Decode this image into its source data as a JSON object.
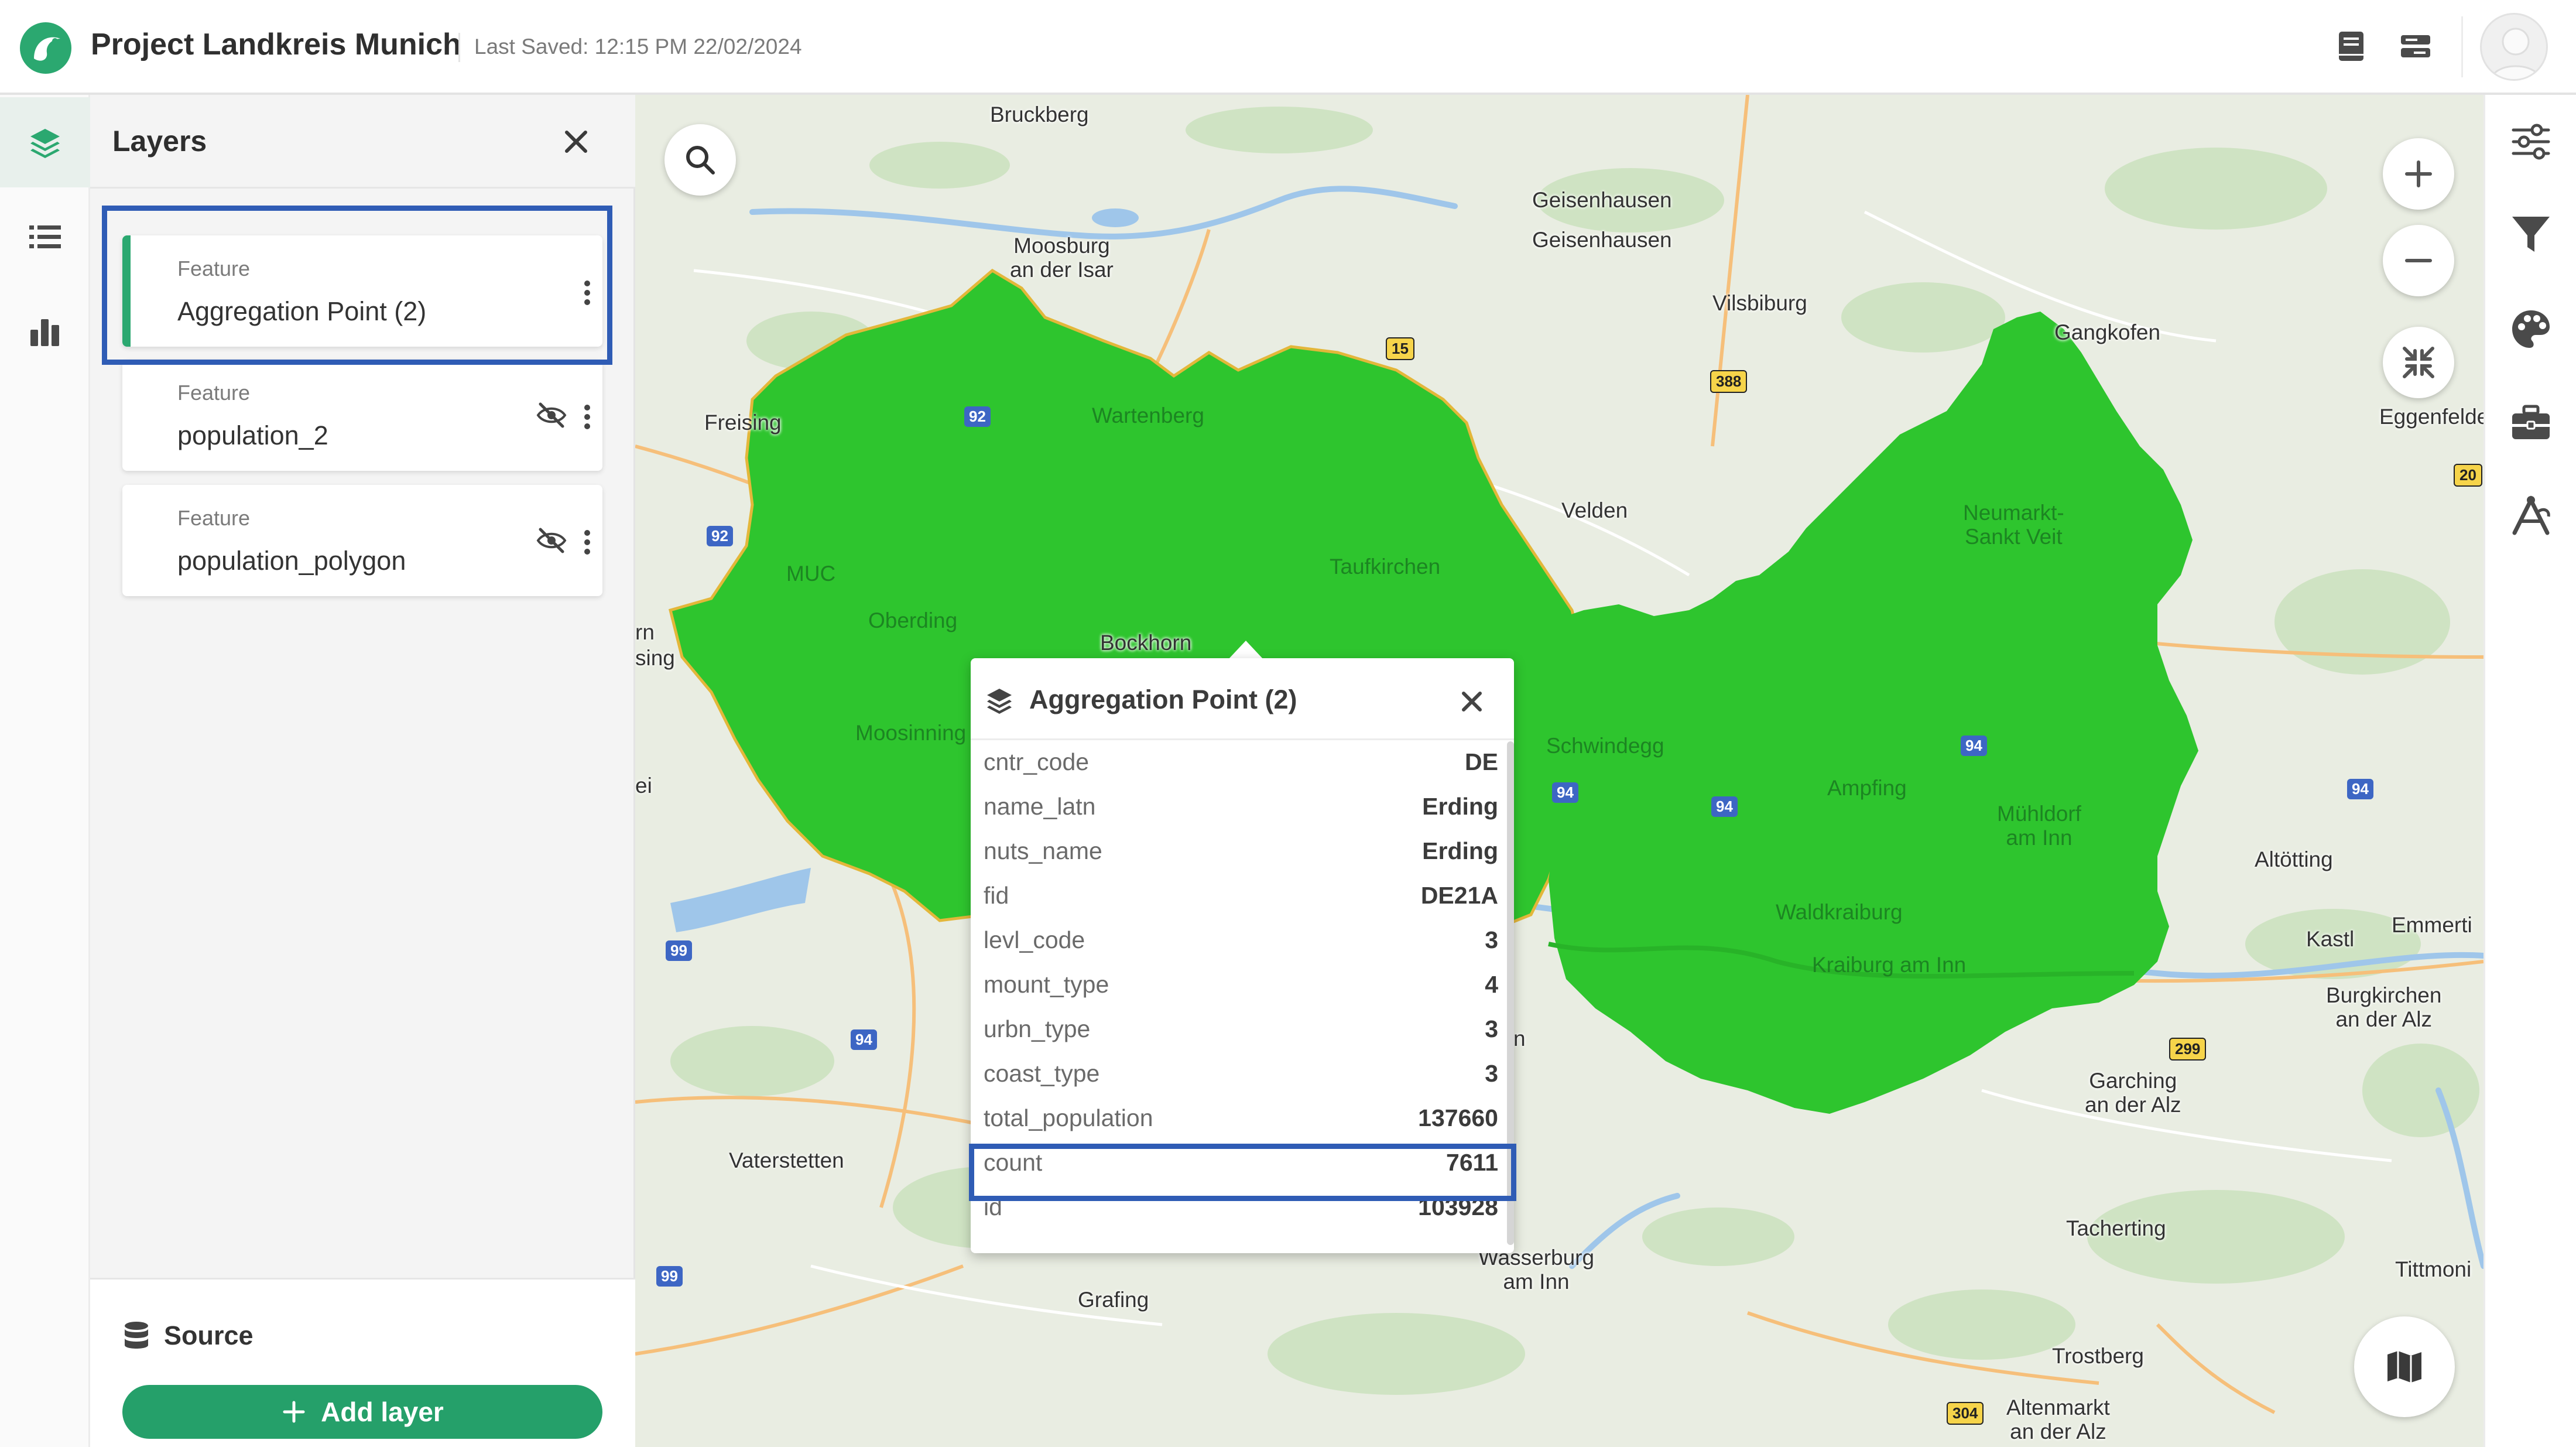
{
  "header": {
    "app_title": "Project Landkreis Munich",
    "last_saved": "Last Saved: 12:15 PM 22/02/2024",
    "icons": [
      "docs-icon",
      "settings-panel-icon",
      "user-avatar"
    ]
  },
  "left_rail": {
    "items": [
      "layers-icon",
      "legend-list-icon",
      "chart-icon"
    ],
    "active": "layers-icon"
  },
  "layers_panel": {
    "title": "Layers",
    "layers": [
      {
        "type": "Feature",
        "name": "Aggregation Point (2)",
        "visible": true,
        "selected": true
      },
      {
        "type": "Feature",
        "name": "population_2",
        "visible": false
      },
      {
        "type": "Feature",
        "name": "population_polygon",
        "visible": false
      }
    ],
    "source_label": "Source",
    "add_layer_label": "Add layer"
  },
  "map": {
    "places": {
      "bruckberg": "Bruckberg",
      "geisenhausen1": "Geisenhausen",
      "geisenhausen2": "Geisenhausen",
      "moosburg": "Moosburg\nan der Isar",
      "vilsbiburg": "Vilsbiburg",
      "gangkofen": "Gangkofen",
      "freising": "Freising",
      "wartenberg": "Wartenberg",
      "eggenfelden": "Eggenfelde",
      "velden": "Velden",
      "neumarkt": "Neumarkt-\nSankt Veit",
      "muc": "MUC",
      "taufkirchen": "Taufkirchen",
      "oberding": "Oberding",
      "bockhorn": "Bockhorn",
      "moosinning": "Moosinning",
      "schwindegg": "Schwindegg",
      "ampfing": "Ampfing",
      "muhldorf": "Mühldorf\nam Inn",
      "altotting": "Altötting",
      "waldkraiburg": "Waldkraiburg",
      "kraiburg": "Kraiburg am Inn",
      "kastl": "Kastl",
      "emmerting": "Emmerti",
      "burgkirchen": "Burgkirchen\nan der Alz",
      "garching": "Garching\nan der Alz",
      "vaterstetten": "Vaterstetten",
      "tacherting": "Tacherting",
      "wasserburg": "Wasserburg\nam Inn",
      "tittmoning": "Tittmoni",
      "grafing": "Grafing",
      "trostberg": "Trostberg",
      "altenmarkt": "Altenmarkt\nan der Alz",
      "edge_rn": "rn",
      "edge_sing": "sing",
      "edge_ei": "ei",
      "edge_n": "n"
    },
    "shields": {
      "b15": "15",
      "b388": "388",
      "a92a": "92",
      "a92b": "92",
      "b20": "20",
      "a94a": "94",
      "a94b": "94",
      "a94c": "94",
      "a94d": "94",
      "a94e": "94",
      "a99a": "99",
      "a99b": "99",
      "b299": "299",
      "b304": "304"
    },
    "controls": [
      "search-icon",
      "zoom-in-icon",
      "zoom-out-icon",
      "fit-extent-icon",
      "basemap-icon"
    ]
  },
  "popup": {
    "title": "Aggregation Point (2)",
    "rows": [
      {
        "key": "cntr_code",
        "value": "DE"
      },
      {
        "key": "name_latn",
        "value": "Erding"
      },
      {
        "key": "nuts_name",
        "value": "Erding"
      },
      {
        "key": "fid",
        "value": "DE21A"
      },
      {
        "key": "levl_code",
        "value": "3"
      },
      {
        "key": "mount_type",
        "value": "4"
      },
      {
        "key": "urbn_type",
        "value": "3"
      },
      {
        "key": "coast_type",
        "value": "3"
      },
      {
        "key": "total_population",
        "value": "137660"
      },
      {
        "key": "count",
        "value": "7611"
      },
      {
        "key": "id",
        "value": "103928"
      }
    ],
    "highlighted_row": "count"
  },
  "right_rail": {
    "tools": [
      "layer-settings-icon",
      "filter-icon",
      "style-palette-icon",
      "toolbox-icon",
      "scenario-icon"
    ]
  },
  "colors": {
    "accent": "#2ba870",
    "aggregation_fill": "#2ec52e",
    "selection_box": "#2f5cb5",
    "map_background": "#e9ede2"
  }
}
